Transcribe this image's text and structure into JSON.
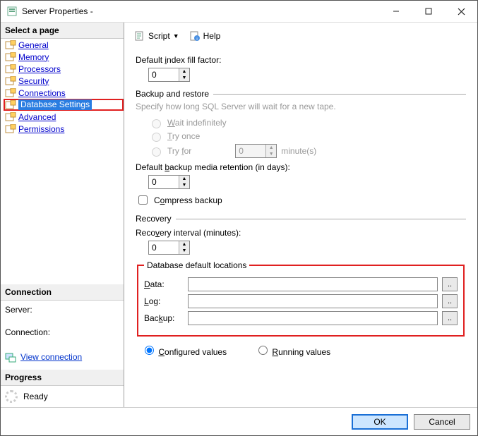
{
  "titlebar": {
    "title": "Server Properties -"
  },
  "sidebar": {
    "select_page_header": "Select a page",
    "items": [
      {
        "label": "General"
      },
      {
        "label": "Memory"
      },
      {
        "label": "Processors"
      },
      {
        "label": "Security"
      },
      {
        "label": "Connections"
      },
      {
        "label": "Database Settings"
      },
      {
        "label": "Advanced"
      },
      {
        "label": "Permissions"
      }
    ],
    "connection_header": "Connection",
    "server_label": "Server:",
    "connection_label": "Connection:",
    "view_connection_label": "View connection ",
    "progress_header": "Progress",
    "ready_label": "Ready"
  },
  "toolbar": {
    "script_label": "Script",
    "help_label": "Help"
  },
  "main": {
    "fill_factor_label": "Default index fill factor:",
    "fill_factor_value": "0",
    "backup_restore_title": "Backup and restore",
    "backup_restore_hint": "Specify how long SQL Server will wait for a new tape.",
    "wait_indef_label": "Wait indefinitely",
    "try_once_label": "Try once",
    "try_for_label": "Try for",
    "try_for_value": "0",
    "try_for_unit": "minute(s)",
    "retention_label": "Default backup media retention (in days):",
    "retention_value": "0",
    "compress_label": "Compress backup",
    "recovery_title": "Recovery",
    "recovery_interval_label": "Recovery interval (minutes):",
    "recovery_interval_value": "0",
    "locations_title": "Database default locations",
    "data_label": "Data:",
    "log_label": "Log:",
    "backup_label": "Backup:",
    "browse_label": "..",
    "configured_label": "Configured values",
    "running_label": "Running values"
  },
  "footer": {
    "ok_label": "OK",
    "cancel_label": "Cancel"
  }
}
